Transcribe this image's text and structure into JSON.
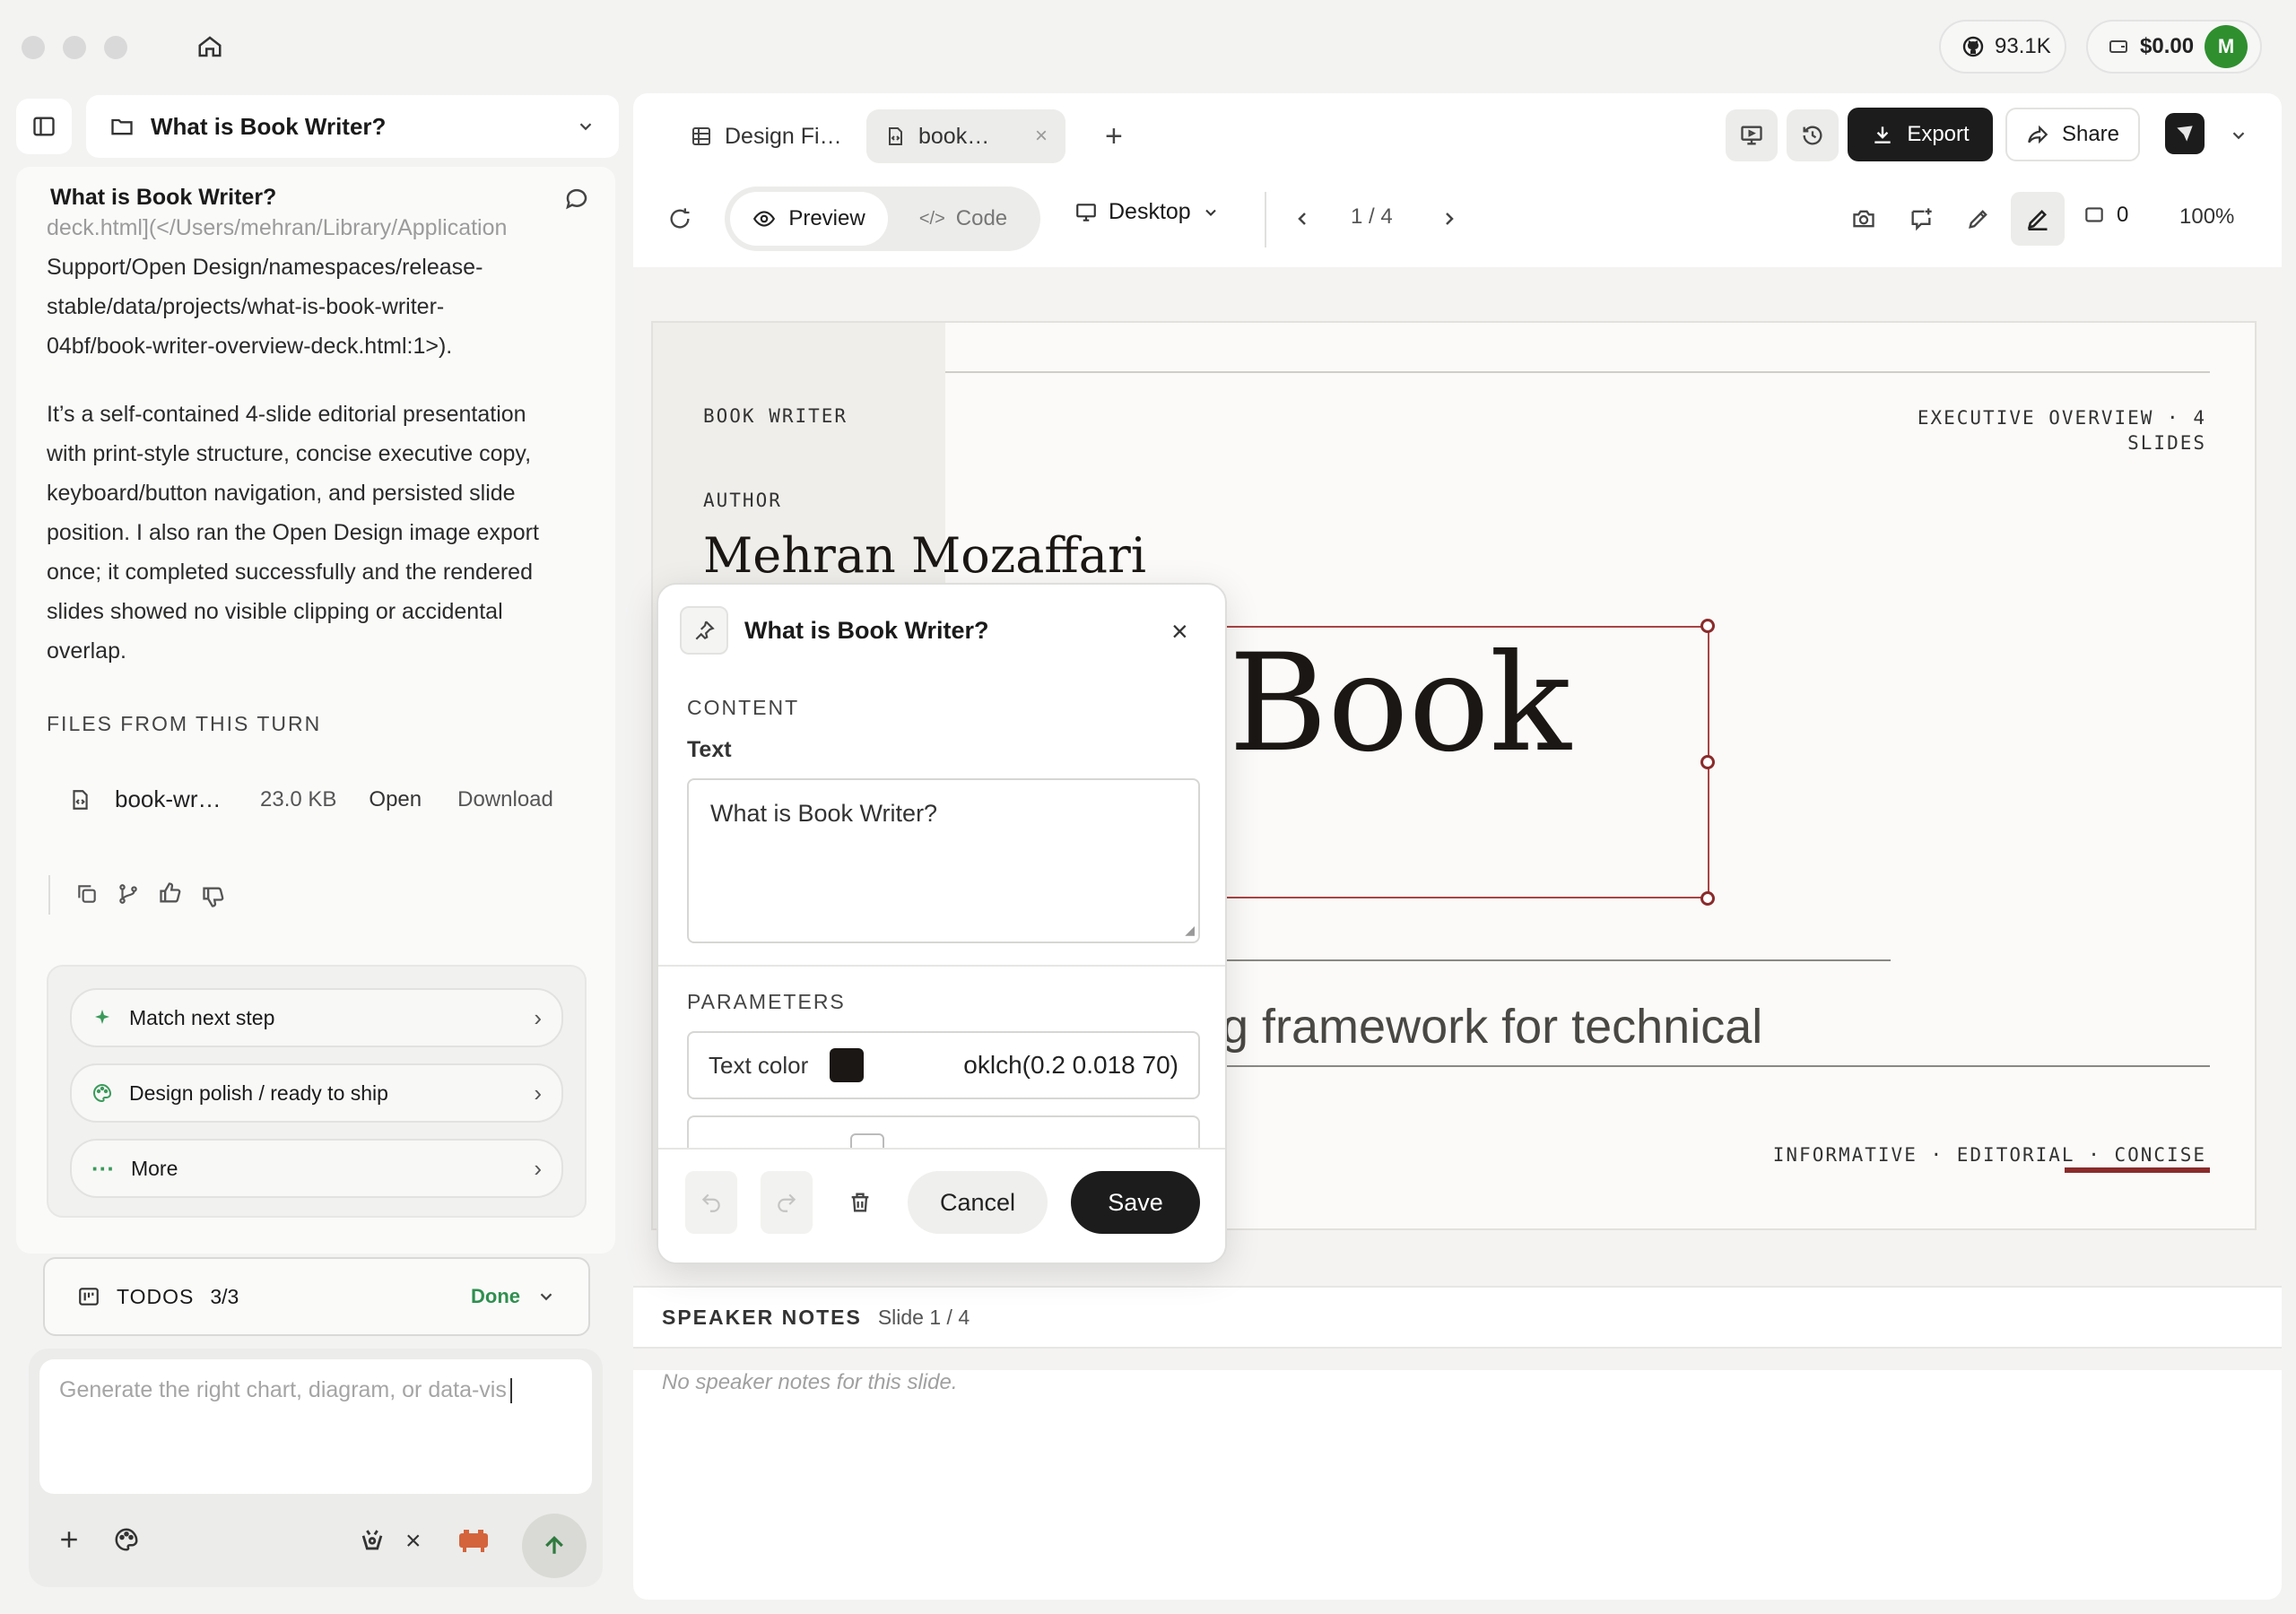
{
  "window": {
    "github_stars": "93.1K",
    "balance": "$0.00",
    "avatar_initial": "M"
  },
  "sidebar": {
    "project_title": "What is Book Writer?",
    "chat_title": "What is Book Writer?",
    "path_lines": [
      "deck.html](</Users/mehran/Library/Application",
      "Support/Open Design/namespaces/release-",
      "stable/data/projects/what-is-book-writer-",
      "04bf/book-writer-overview-deck.html:1>)."
    ],
    "paragraph_lines": [
      "It’s a self-contained 4-slide editorial presentation",
      "with print-style structure, concise executive copy,",
      "keyboard/button navigation, and persisted slide",
      "position. I also ran the Open Design image export",
      "once; it completed successfully and the rendered",
      "slides showed no visible clipping or accidental",
      "overlap."
    ],
    "files_heading": "FILES FROM THIS TURN",
    "file": {
      "name": "book-wr…",
      "size": "23.0 KB",
      "open": "Open",
      "download": "Download"
    },
    "suggestions": [
      {
        "label": "Match next step",
        "icon": "sparkle-icon"
      },
      {
        "label": "Design polish / ready to ship",
        "icon": "palette-icon"
      },
      {
        "label": "More",
        "icon": "more-dots-icon"
      }
    ],
    "todos": {
      "label": "TODOS",
      "count": "3/3",
      "status": "Done"
    },
    "composer_placeholder": "Generate the right chart, diagram, or data-vis"
  },
  "tabs": [
    {
      "label": "Design Fi…",
      "icon": "grid-icon"
    },
    {
      "label": "book…",
      "icon": "file-code-icon"
    }
  ],
  "toolbar": {
    "export_label": "Export",
    "share_label": "Share",
    "preview_label": "Preview",
    "code_label": "Code",
    "device_label": "Desktop",
    "page_indicator": "1 / 4",
    "comment_count": "0",
    "zoom": "100%"
  },
  "slide": {
    "brand": "BOOK WRITER",
    "overview_line1": "EXECUTIVE OVERVIEW · 4",
    "overview_line2": "SLIDES",
    "author_label": "AUTHOR",
    "author_name": "Mehran Mozaffari",
    "headline_fragment": "Book",
    "subtitle_fragment": "g framework for technical",
    "tags": "INFORMATIVE · EDITORIAL · CONCISE"
  },
  "notes": {
    "heading": "SPEAKER NOTES",
    "slide_label": "Slide 1 / 4",
    "empty_text": "No speaker notes for this slide."
  },
  "popup": {
    "title": "What is Book Writer?",
    "content_heading": "CONTENT",
    "text_label": "Text",
    "text_value": "What is Book Writer?",
    "params_heading": "PARAMETERS",
    "text_color_label": "Text color",
    "text_color_value": "oklch(0.2 0.018 70)",
    "text_color_swatch": "#1a1714",
    "cancel_label": "Cancel",
    "save_label": "Save"
  },
  "colors": {
    "accent_red": "#8a2b2b",
    "dark_button": "#1c1c1c",
    "done_green": "#2f8f4f"
  }
}
